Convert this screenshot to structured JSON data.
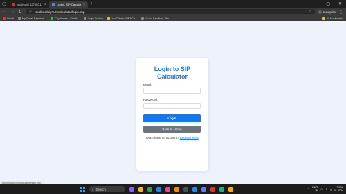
{
  "browser": {
    "tabs": [
      {
        "label": "localhost / 127.0.0.1 / sip_calcu",
        "active": false
      },
      {
        "label": "Login - SIP Calculator",
        "active": true
      }
    ],
    "url": "localhost/sip%20calculator/login.php",
    "profile_label": "Incognito",
    "bookmarks": [
      "Gmail",
      "My Gmail Beaches...",
      "City Maven - Clickit...",
      "Login Toolbar",
      "YouTube to MP3 Co...",
      "Go to Sandbox - Sa..."
    ],
    "bookmarks_right": "All Bookmarks",
    "status_url": "localhost/sip%20calculator/index.php"
  },
  "login": {
    "title_line1": "Login to SIP",
    "title_line2": "Calculator",
    "email_label": "Email:",
    "email_value": "",
    "password_label": "Password:",
    "password_value": "",
    "login_button": "Login",
    "back_button": "Back to Home",
    "register_prompt": "Don't have an account?",
    "register_link": "Register Now"
  },
  "taskbar": {
    "search_placeholder": "Search",
    "lang": "ENG",
    "lang2": "IN",
    "time": "23:06",
    "date": "21-09-2024"
  },
  "colors": {
    "accent": "#1e7be6",
    "login_button": "#0d79f2",
    "back_button": "#6c757d",
    "page_bg": "#eef3fb"
  }
}
